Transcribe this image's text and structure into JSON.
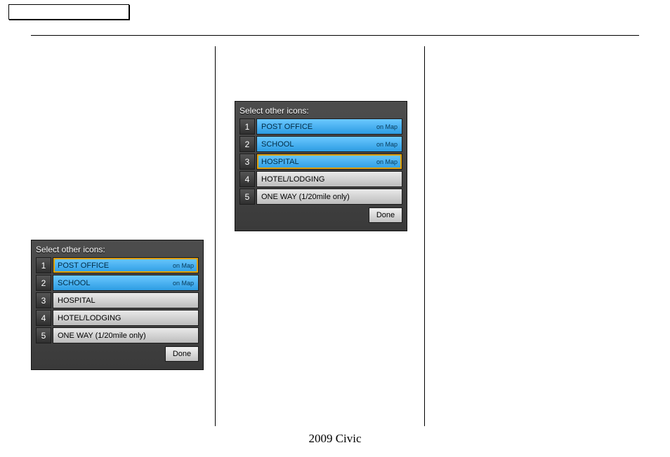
{
  "footer": "2009  Civic",
  "panelA": {
    "title": "Select other icons:",
    "done": "Done",
    "highlightIndex": 0,
    "rows": [
      {
        "num": "1",
        "label": "POST OFFICE",
        "status": "on Map",
        "on": true
      },
      {
        "num": "2",
        "label": "SCHOOL",
        "status": "on Map",
        "on": true
      },
      {
        "num": "3",
        "label": "HOSPITAL",
        "status": "",
        "on": false
      },
      {
        "num": "4",
        "label": "HOTEL/LODGING",
        "status": "",
        "on": false
      },
      {
        "num": "5",
        "label": "ONE WAY (1/20mile only)",
        "status": "",
        "on": false
      }
    ]
  },
  "panelB": {
    "title": "Select other icons:",
    "done": "Done",
    "highlightIndex": 2,
    "rows": [
      {
        "num": "1",
        "label": "POST OFFICE",
        "status": "on Map",
        "on": true
      },
      {
        "num": "2",
        "label": "SCHOOL",
        "status": "on Map",
        "on": true
      },
      {
        "num": "3",
        "label": "HOSPITAL",
        "status": "on Map",
        "on": true
      },
      {
        "num": "4",
        "label": "HOTEL/LODGING",
        "status": "",
        "on": false
      },
      {
        "num": "5",
        "label": "ONE WAY (1/20mile only)",
        "status": "",
        "on": false
      }
    ]
  }
}
